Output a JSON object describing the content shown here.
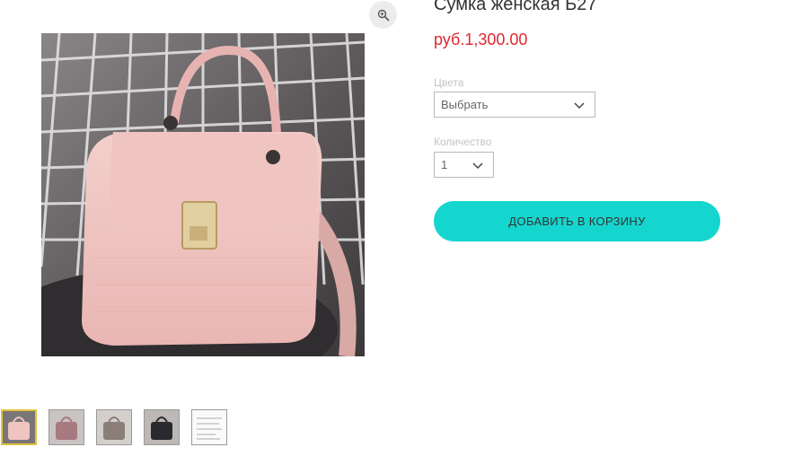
{
  "product": {
    "title": "Сумка женская Б27",
    "price": "руб.1,300.00"
  },
  "options": {
    "color_label": "Цвета",
    "color_value": "Выбрать",
    "quantity_label": "Количество",
    "quantity_value": "1"
  },
  "actions": {
    "add_to_cart_label": "ДОБАВИТЬ В КОРЗИНУ"
  },
  "gallery": {
    "thumbnails": [
      "pink",
      "mauve",
      "grey",
      "black",
      "size-chart"
    ]
  },
  "colors": {
    "price": "#e0262f",
    "button": "#14d6cf",
    "active_thumb_border": "#e2c33a"
  },
  "icons": {
    "zoom": "magnifier-icon",
    "dropdown": "chevron-down-icon"
  }
}
